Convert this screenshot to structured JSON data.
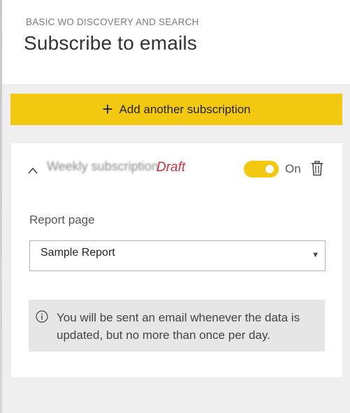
{
  "panel": {
    "subtitle": "BASIC WO DISCOVERY AND SEARCH",
    "title": "Subscribe to emails"
  },
  "add_button": {
    "label": "Add another subscription",
    "icon": "plus-icon"
  },
  "subscription": {
    "name_redacted": "Weekly subscription",
    "status_tag": "Draft",
    "toggle_state_label": "On",
    "toggle_on": true,
    "report_page_label": "Report page",
    "report_page_value": "Sample Report",
    "info_message": "You will be sent an email whenever the data is updated, but no more than once per day."
  },
  "colors": {
    "accent_yellow": "#f2c811",
    "draft_red": "#c9323f",
    "panel_gray": "#efefef",
    "info_bg": "#e6e6e6"
  },
  "icons": [
    "plus-icon",
    "chevron-up-icon",
    "trash-icon",
    "info-icon",
    "caret-down-icon"
  ]
}
